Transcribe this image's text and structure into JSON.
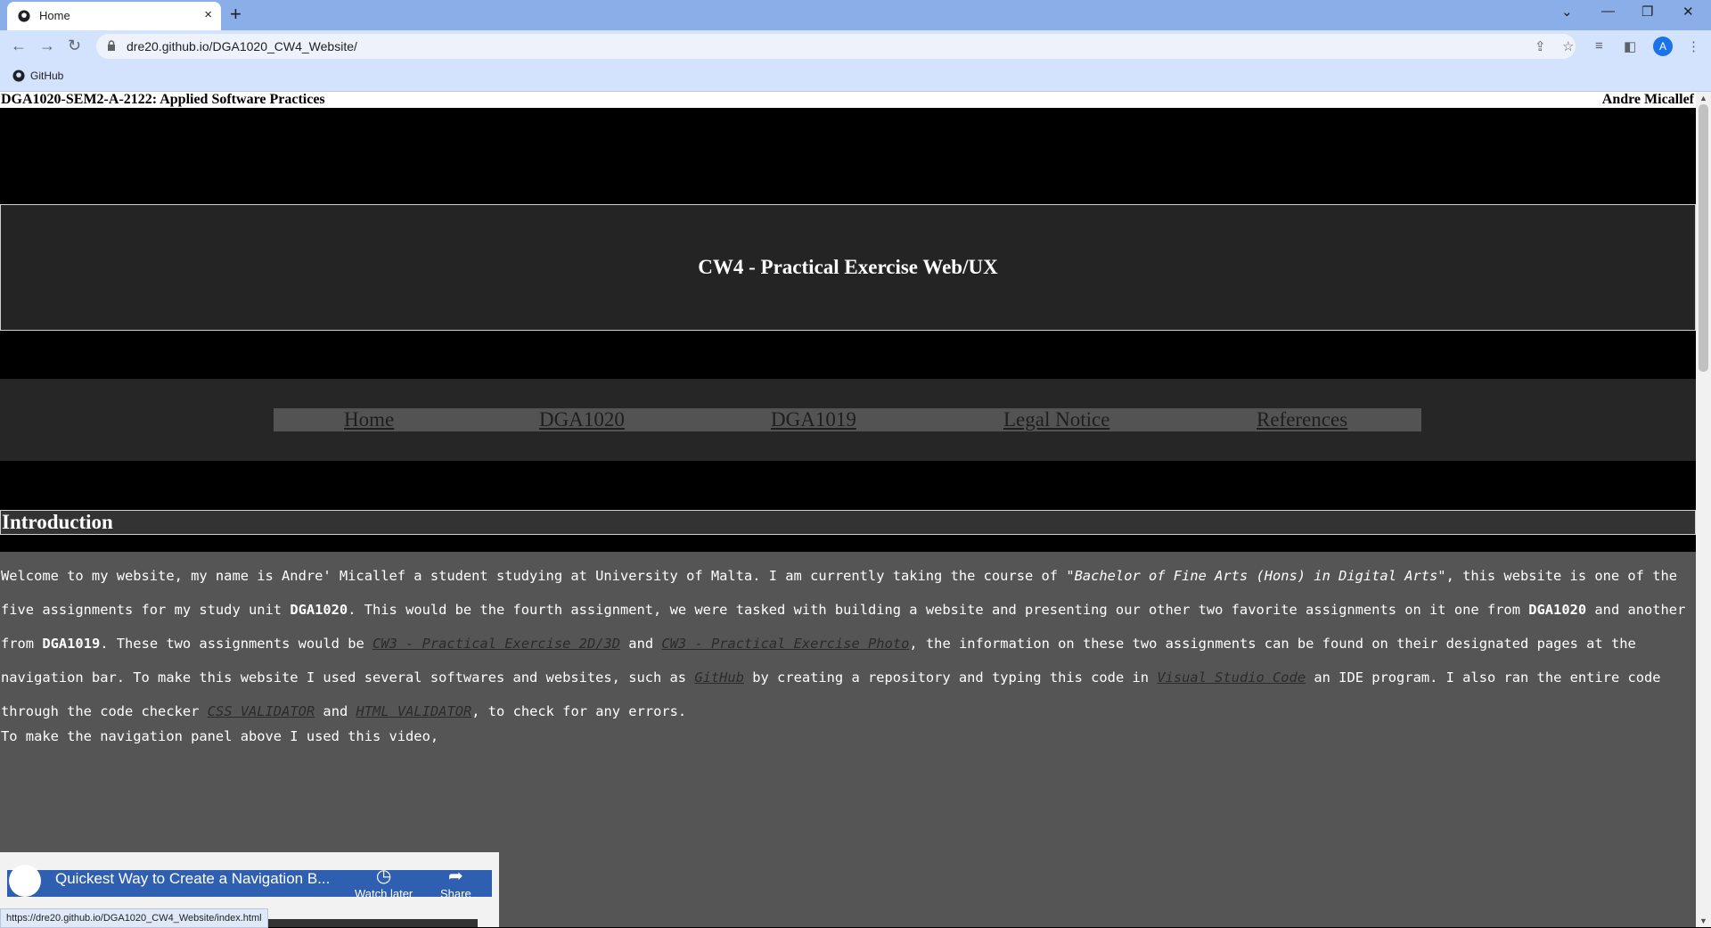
{
  "browser": {
    "tab_title": "Home",
    "tab_close": "×",
    "new_tab": "+",
    "url": "dre20.github.io/DGA1020_CW4_Website/",
    "bookmark": "GitHub",
    "avatar_letter": "A",
    "status_url": "https://dre20.github.io/DGA1020_CW4_Website/index.html"
  },
  "header": {
    "course": "DGA1020-SEM2-A-2122: Applied Software Practices",
    "author": "Andre Micallef"
  },
  "banner": {
    "title": "CW4 - Practical Exercise Web/UX"
  },
  "nav": {
    "items": [
      "Home",
      "DGA1020",
      "DGA1019",
      "Legal Notice",
      "References"
    ]
  },
  "intro": {
    "heading": "Introduction",
    "p1": "Welcome to my website, my name is Andre' Micallef a student studying at University of Malta. I am currently taking the course of",
    "course_name": "\"Bachelor of Fine Arts (Hons) in Digital Arts\"",
    "p2": ", this website is one of the five assignments for my study unit",
    "unit1": "DGA1020",
    "p3": ". This would be the fourth assignment, we were tasked with building a website and presenting our other two favorite assignments on it one from",
    "unit1b": "DGA1020",
    "p4": "and another from",
    "unit2": "DGA1019",
    "p5": ". These two assignments would be",
    "link1": "CW3 - Practical Exercise 2D/3D",
    "p6": "and",
    "link2": "CW3 - Practical Exercise Photo",
    "p7": ", the information on these two assignments can be found on their designated pages at the navigation bar. To make this website I used several softwares and websites, such as",
    "link3": "GitHub",
    "p8": "by creating a repository and typing this code in",
    "link4": "Visual Studio Code",
    "p9": "an IDE program. I also ran the entire code through the code checker",
    "link5": "CSS VALIDATOR",
    "p10": "and",
    "link6": "HTML VALIDATOR",
    "p11": ", to check for any errors.",
    "video_lead": "To make the navigation panel above I used this video,"
  },
  "video": {
    "title": "Quickest Way to Create a Navigation B...",
    "watch_later": "Watch later",
    "share": "Share"
  }
}
